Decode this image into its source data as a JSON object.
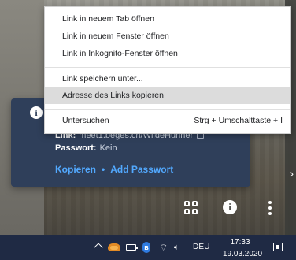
{
  "context_menu": {
    "items": [
      {
        "label": "Link in neuem Tab öffnen"
      },
      {
        "label": "Link in neuem Fenster öffnen"
      },
      {
        "label": "Link in Inkognito-Fenster öffnen"
      },
      {
        "label": "Link speichern unter..."
      },
      {
        "label": "Adresse des Links kopieren"
      },
      {
        "label": "Untersuchen",
        "shortcut": "Strg + Umschalttaste + I"
      }
    ]
  },
  "info_card": {
    "link_label": "Link:",
    "link_value": "meet1.beges.ch/WildeHuhner",
    "password_label": "Passwort:",
    "password_value": "Kein",
    "copy_label": "Kopieren",
    "separator": "•",
    "add_password_label": "Add Passwort"
  },
  "taskbar": {
    "language": "DEU",
    "time": "17:33",
    "date": "19.03.2020"
  },
  "icons": {
    "info": "info-icon",
    "grid": "grid-view-icon",
    "more": "kebab-menu-icon",
    "copy": "copy-icon"
  }
}
